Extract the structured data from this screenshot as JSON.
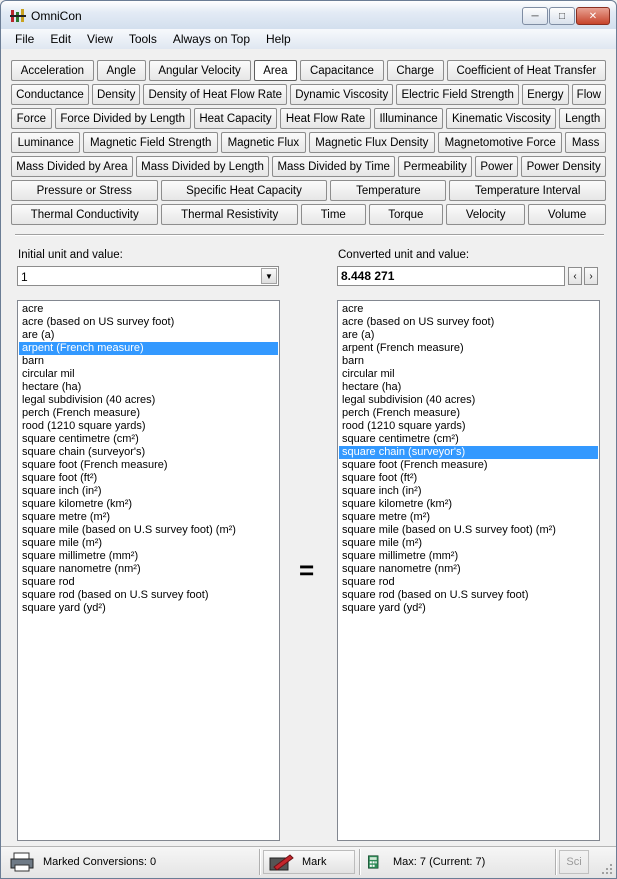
{
  "window": {
    "title": "OmniCon"
  },
  "menu": [
    "File",
    "Edit",
    "View",
    "Tools",
    "Always on Top",
    "Help"
  ],
  "categories": [
    [
      "Acceleration",
      "Angle",
      "Angular Velocity",
      "Area",
      "Capacitance",
      "Charge",
      "Coefficient of Heat Transfer"
    ],
    [
      "Conductance",
      "Density",
      "Density of Heat Flow Rate",
      "Dynamic Viscosity",
      "Electric Field Strength",
      "Energy",
      "Flow"
    ],
    [
      "Force",
      "Force Divided by Length",
      "Heat Capacity",
      "Heat Flow Rate",
      "Illuminance",
      "Kinematic Viscosity",
      "Length"
    ],
    [
      "Luminance",
      "Magnetic Field Strength",
      "Magnetic Flux",
      "Magnetic Flux Density",
      "Magnetomotive Force",
      "Mass"
    ],
    [
      "Mass Divided by Area",
      "Mass Divided by Length",
      "Mass Divided by Time",
      "Permeability",
      "Power",
      "Power Density"
    ],
    [
      "Pressure or Stress",
      "Specific Heat Capacity",
      "Temperature",
      "Temperature Interval"
    ],
    [
      "Thermal Conductivity",
      "Thermal Resistivity",
      "Time",
      "Torque",
      "Velocity",
      "Volume"
    ]
  ],
  "active_category": "Area",
  "left_panel": {
    "label": "Initial unit and value:",
    "value": "1",
    "selected_index": 3
  },
  "right_panel": {
    "label": "Converted unit and value:",
    "value": "8.448 271",
    "selected_index": 11
  },
  "units": [
    "acre",
    "acre (based on US survey foot)",
    "are (a)",
    "arpent (French measure)",
    "barn",
    "circular mil",
    "hectare (ha)",
    "legal subdivision (40 acres)",
    "perch (French measure)",
    "rood (1210 square yards)",
    "square centimetre (cm²)",
    "square chain (surveyor's)",
    "square foot (French measure)",
    "square foot (ft²)",
    "square inch (in²)",
    "square kilometre (km²)",
    "square metre (m²)",
    "square mile (based on U.S survey foot) (m²)",
    "square mile (m²)",
    "square millimetre (mm²)",
    "square nanometre (nm²)",
    "square rod",
    "square rod (based on U.S survey foot)",
    "square yard (yd²)"
  ],
  "equals_sign": "=",
  "status": {
    "marked": "Marked Conversions: 0",
    "mark_button": "Mark",
    "max": "Max: 7  (Current: 7)",
    "sci": "Sci"
  }
}
